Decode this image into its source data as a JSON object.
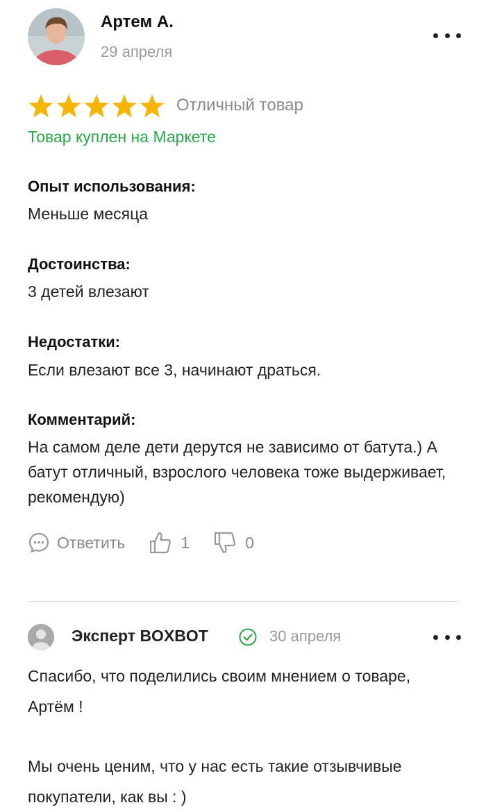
{
  "review": {
    "author": "Артем А.",
    "date": "29 апреля",
    "rating": 5,
    "rating_max": 5,
    "rating_text": "Отличный товар",
    "purchased": "Товар куплен на Маркете",
    "sections": [
      {
        "title": "Опыт использования:",
        "text": "Меньше месяца"
      },
      {
        "title": "Достоинства:",
        "text": "3 детей влезают"
      },
      {
        "title": "Недостатки:",
        "text": "Если влезают все 3, начинают драться."
      },
      {
        "title": "Комментарий:",
        "text": "На самом деле дети дерутся не зависимо от батута.) А батут отличный, взрослого человека тоже выдерживает, рекомендую)"
      }
    ],
    "reply_label": "Ответить",
    "likes": "1",
    "dislikes": "0"
  },
  "answer": {
    "author": "Эксперт BOXBOT",
    "date": "30 апреля",
    "text1": "Спасибо, что поделились своим мнением о товаре, Артём !",
    "text2": "Мы очень ценим, что у нас есть такие отзывчивые покупатели, как вы : )"
  },
  "colors": {
    "star": "#f7b500",
    "green": "#29a847",
    "muted": "#888888"
  },
  "icons": [
    "more-icon",
    "star-icon",
    "comment-icon",
    "thumbs-up-icon",
    "thumbs-down-icon",
    "verified-check-icon"
  ]
}
